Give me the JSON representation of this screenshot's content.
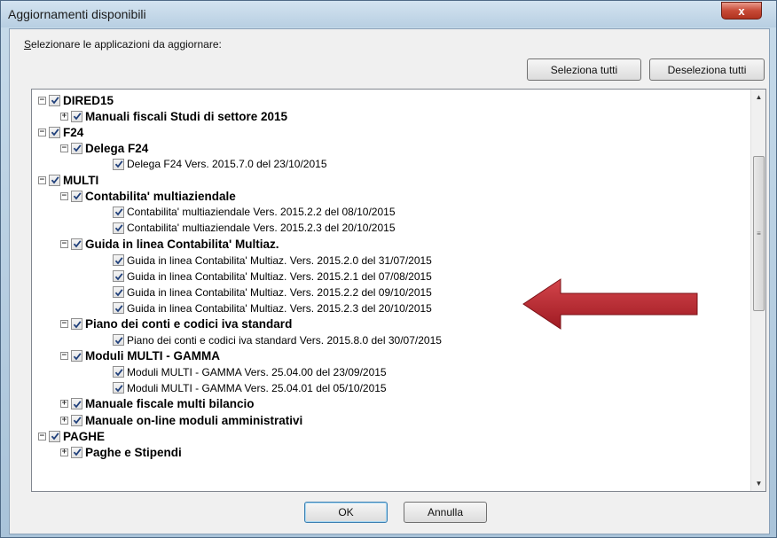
{
  "window": {
    "title": "Aggiornamenti disponibili",
    "close_label": "x"
  },
  "prompt": {
    "label_underlined": "S",
    "label_rest": "elezionare le applicazioni da aggiornare:"
  },
  "buttons": {
    "select_all": "Seleziona tutti",
    "deselect_all": "Deseleziona tutti",
    "ok": "OK",
    "cancel": "Annulla"
  },
  "tree": [
    {
      "label": "DIRED15",
      "level": 0,
      "expander": "-",
      "bold": true
    },
    {
      "label": "Manuali fiscali Studi di settore 2015",
      "level": 1,
      "expander": "+",
      "bold": true
    },
    {
      "label": "F24",
      "level": 0,
      "expander": "-",
      "bold": true
    },
    {
      "label": "Delega F24",
      "level": 1,
      "expander": "-",
      "bold": true
    },
    {
      "label": "Delega F24 Vers. 2015.7.0 del 23/10/2015",
      "level": 2,
      "expander": "",
      "bold": false
    },
    {
      "label": "MULTI",
      "level": 0,
      "expander": "-",
      "bold": true
    },
    {
      "label": "Contabilita' multiaziendale",
      "level": 1,
      "expander": "-",
      "bold": true
    },
    {
      "label": "Contabilita' multiaziendale Vers. 2015.2.2 del 08/10/2015",
      "level": 2,
      "expander": "",
      "bold": false
    },
    {
      "label": "Contabilita' multiaziendale Vers. 2015.2.3 del 20/10/2015",
      "level": 2,
      "expander": "",
      "bold": false
    },
    {
      "label": "Guida in linea Contabilita' Multiaz.",
      "level": 1,
      "expander": "-",
      "bold": true
    },
    {
      "label": "Guida in linea Contabilita' Multiaz. Vers. 2015.2.0 del 31/07/2015",
      "level": 2,
      "expander": "",
      "bold": false
    },
    {
      "label": "Guida in linea Contabilita' Multiaz. Vers. 2015.2.1 del 07/08/2015",
      "level": 2,
      "expander": "",
      "bold": false
    },
    {
      "label": "Guida in linea Contabilita' Multiaz. Vers. 2015.2.2 del 09/10/2015",
      "level": 2,
      "expander": "",
      "bold": false
    },
    {
      "label": "Guida in linea Contabilita' Multiaz. Vers. 2015.2.3 del 20/10/2015",
      "level": 2,
      "expander": "",
      "bold": false
    },
    {
      "label": "Piano dei conti e codici iva standard",
      "level": 1,
      "expander": "-",
      "bold": true
    },
    {
      "label": "Piano dei conti e codici iva standard Vers. 2015.8.0 del 30/07/2015",
      "level": 2,
      "expander": "",
      "bold": false
    },
    {
      "label": "Moduli MULTI - GAMMA",
      "level": 1,
      "expander": "-",
      "bold": true
    },
    {
      "label": "Moduli MULTI - GAMMA Vers. 25.04.00 del 23/09/2015",
      "level": 2,
      "expander": "",
      "bold": false
    },
    {
      "label": "Moduli MULTI - GAMMA Vers. 25.04.01 del 05/10/2015",
      "level": 2,
      "expander": "",
      "bold": false
    },
    {
      "label": "Manuale fiscale multi bilancio",
      "level": 1,
      "expander": "+",
      "bold": true
    },
    {
      "label": "Manuale on-line moduli amministrativi",
      "level": 1,
      "expander": "+",
      "bold": true
    },
    {
      "label": "PAGHE",
      "level": 0,
      "expander": "-",
      "bold": true
    },
    {
      "label": "Paghe e Stipendi",
      "level": 1,
      "expander": "+",
      "bold": true
    }
  ],
  "colors": {
    "arrow": "#c0262d",
    "check": "#1f3f7a"
  },
  "icons": {
    "close": "close-icon",
    "check": "check-icon",
    "arrow": "red-arrow-icon"
  }
}
